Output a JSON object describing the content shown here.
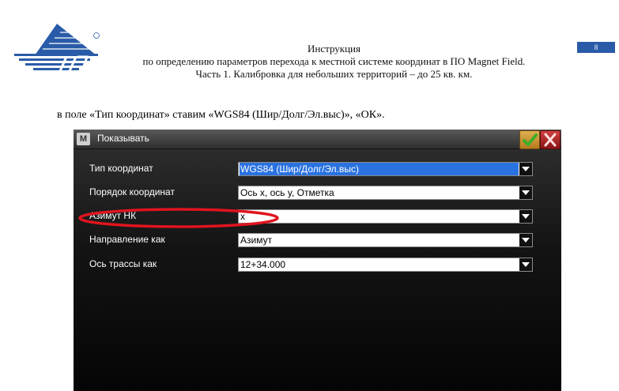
{
  "header": {
    "page_number": "8",
    "title_line1": "Инструкция",
    "title_line2": "по определению параметров перехода к местной системе координат в ПО Magnet Field.",
    "title_line3": "Часть 1. Калибровка для небольших территорий – до 25 кв. км."
  },
  "body_text": "в поле «Тип координат» ставим «WGS84 (Шир/Долг/Эл.выс)», «ОК».",
  "dialog": {
    "app_icon_letter": "M",
    "title": "Показывать",
    "rows": [
      {
        "label": "Тип координат",
        "value": "WGS84 (Шир/Долг/Эл.выс)"
      },
      {
        "label": "Порядок координат",
        "value": "Ось x, ось y, Отметка"
      },
      {
        "label": "Азимут НК",
        "value": "x"
      },
      {
        "label": "Направление как",
        "value": "Азимут"
      },
      {
        "label": "Ось трассы как",
        "value": "12+34.000"
      }
    ]
  },
  "colors": {
    "selection": "#2a72e0",
    "highlight_ellipse": "#e0141e",
    "logo_blue": "#2a5ba8"
  }
}
